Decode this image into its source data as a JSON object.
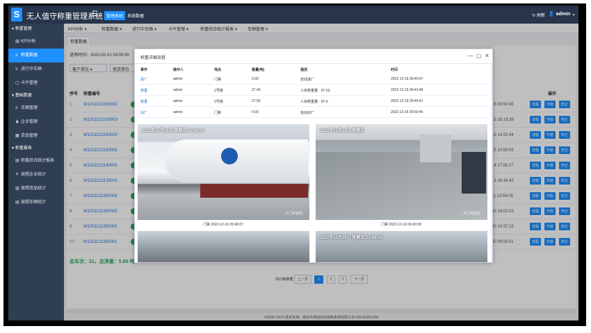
{
  "header": {
    "title": "无人值守称重管理系统",
    "menu_icon": "☰",
    "nav": [
      "管理系统",
      "系统数据"
    ],
    "refresh": "刷新",
    "user": "admin"
  },
  "sidebar": {
    "groups": [
      {
        "label": "称重管理",
        "items": [
          {
            "label": "KPI分析",
            "icon": "bar-chart-icon"
          },
          {
            "label": "称重数据",
            "icon": "list-icon",
            "active": true
          },
          {
            "label": "进行中车辆",
            "icon": "list-icon"
          },
          {
            "label": "卡片管理",
            "icon": "card-icon"
          }
        ]
      },
      {
        "label": "基础数据",
        "items": [
          {
            "label": "车辆管理",
            "icon": "list-icon"
          },
          {
            "label": "企业管理",
            "icon": "user-icon"
          },
          {
            "label": "货品管理",
            "icon": "grid-icon"
          }
        ]
      },
      {
        "label": "称重报表",
        "items": [
          {
            "label": "称重综合统计报表",
            "icon": "table-icon"
          },
          {
            "label": "按照企业统计",
            "icon": "tree-icon"
          },
          {
            "label": "按照货品统计",
            "icon": "bar-chart-icon"
          },
          {
            "label": "按照车辆统计",
            "icon": "table-icon"
          }
        ]
      }
    ]
  },
  "tabs": [
    "KPI分析",
    "称重数据",
    "进行中车辆",
    "卡片管理",
    "称重综合统计报表",
    "车辆管理"
  ],
  "breadcrumb": "称重数据",
  "filters": {
    "time_label": "进场时间：2022-02-01 00:00:00",
    "owner_placeholder": "客户单位",
    "supplier_placeholder": "供货单位"
  },
  "table": {
    "headers": {
      "num": "序号",
      "code": "称重编号",
      "time": "",
      "ops": "操作"
    },
    "rows": [
      {
        "num": "1",
        "code": "W1202212160001",
        "time": "-16 09:50:45"
      },
      {
        "num": "2",
        "code": "W1202212150003",
        "time": "-15 16:18:39"
      },
      {
        "num": "3",
        "code": "W1202212150002",
        "time": "-15 14:20:44"
      },
      {
        "num": "4",
        "code": "W1202212150001",
        "time": "-15 10:59:05"
      },
      {
        "num": "5",
        "code": "W1202212140001",
        "time": "-14 17:06:27"
      },
      {
        "num": "6",
        "code": "W1202212130001",
        "time": "-13 16:16:42"
      },
      {
        "num": "7",
        "code": "W1202211300004",
        "time": "-11 13:54:05"
      },
      {
        "num": "8",
        "code": "W1202211300003",
        "time": "-30 16:02:03"
      },
      {
        "num": "9",
        "code": "W1202211300002",
        "time": "-30 10:37:15"
      },
      {
        "num": "10",
        "code": "W1202211300001",
        "time": "-30 09:50:01"
      }
    ],
    "row_buttons": [
      "流程",
      "作废",
      "修正"
    ],
    "total": "总车次：21，总净重：5.66 吨"
  },
  "pager": {
    "info": "共21条数据",
    "prev": "上一页",
    "pages": [
      "1",
      "2",
      "3"
    ],
    "next": "下一页"
  },
  "footer": "©2006~2023 技术支持：南京玖琦自动化控制系统有限公司 025-83201358",
  "modal": {
    "title": "称重详细流程",
    "minimize": "—",
    "maximize": "▢",
    "close": "✕",
    "headers": [
      "事件",
      "操作人",
      "地点",
      "重量(吨)",
      "描述",
      "时间"
    ],
    "rows": [
      [
        "进厂",
        "admin",
        "门禁",
        "0.00",
        "自动进厂",
        "2022-12-16 09:40:07"
      ],
      [
        "称重",
        "admin",
        "1号磅",
        "27.40",
        "人体称重量：87.63",
        "2022-12-16 09:43:48"
      ],
      [
        "称重",
        "admin",
        "2号磅",
        "27.50",
        "人体称重量：87.6",
        "2022-12-16 09:49:41"
      ],
      [
        "出厂",
        "admin",
        "门禁",
        "0.00",
        "自动出厂",
        "2022-12-16 09:50:45"
      ]
    ],
    "photos": [
      {
        "stamp": "2022年12月16日 星期五 09:43:15",
        "watermark": "大门外监控",
        "caption": "门禁 2022-12-16 09:40:07"
      },
      {
        "stamp": "2022年12月16日 星期五",
        "watermark": "大门内监控",
        "caption": "门禁 2022-12-16 09:40:08"
      },
      {
        "stamp": "",
        "watermark": "",
        "caption": ""
      },
      {
        "stamp": "2022年12月16日 星期五 13:00:52",
        "watermark": "",
        "caption": ""
      }
    ]
  },
  "colors": {
    "header_bg": "#27344a",
    "sidebar_bg": "#2f3e52",
    "accent": "#1e90ff",
    "success": "#27ae60"
  }
}
